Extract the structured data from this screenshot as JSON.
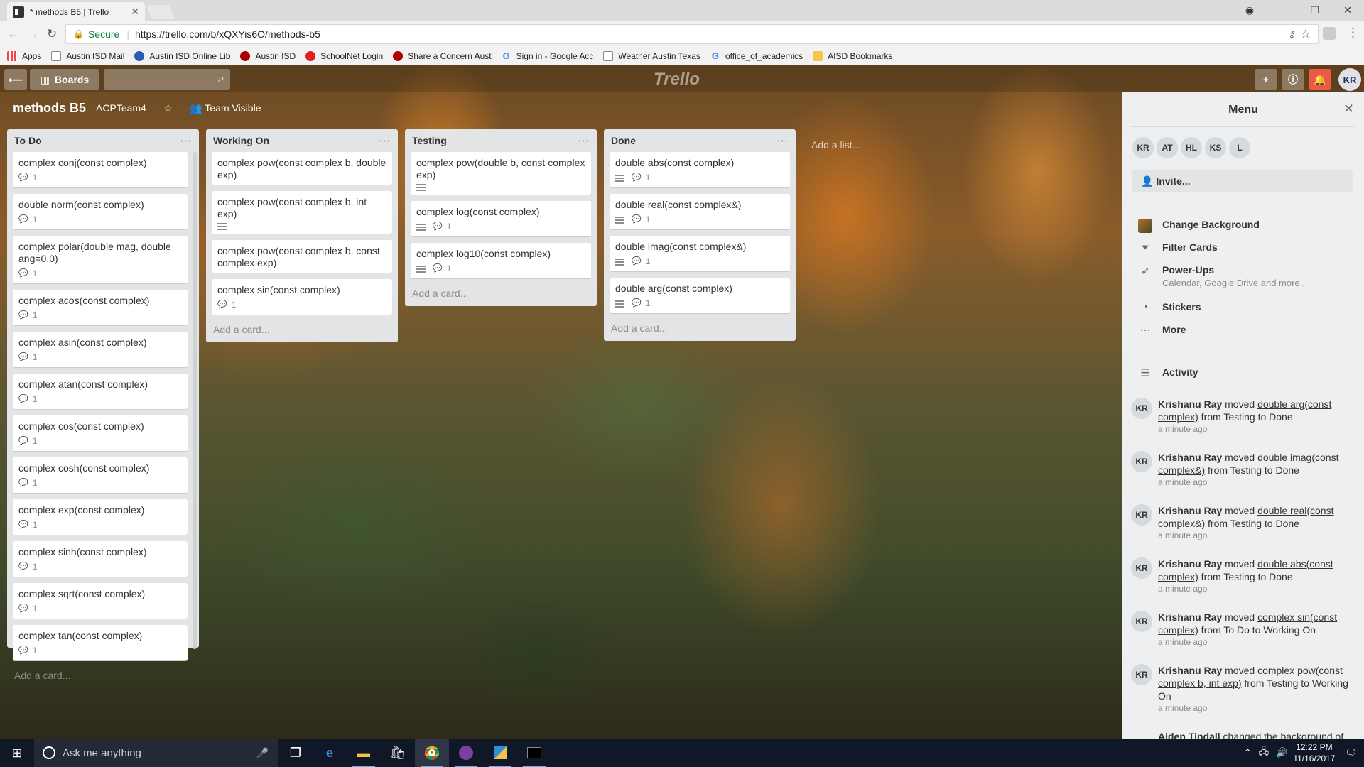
{
  "browser": {
    "tab_title": "* methods B5 | Trello",
    "secure_label": "Secure",
    "url": "https://trello.com/b/xQXYis6O/methods-b5",
    "bookmarks": [
      "Apps",
      "Austin ISD Mail",
      "Austin ISD Online Lib",
      "Austin ISD",
      "SchoolNet Login",
      "Share a Concern Aust",
      "Sign in - Google Acc",
      "Weather Austin Texas",
      "office_of_academics",
      "AISD Bookmarks"
    ]
  },
  "trello": {
    "boards_label": "Boards",
    "logo": "Trello",
    "avatar": "KR",
    "board_title": "methods B5",
    "team": "ACPTeam4",
    "visibility": "Team Visible",
    "add_list": "Add a list...",
    "add_card": "Add a card...",
    "lists": [
      {
        "title": "To Do",
        "cards": [
          {
            "text": "complex conj(const complex)",
            "desc": false,
            "comments": "1"
          },
          {
            "text": "double norm(const complex)",
            "desc": false,
            "comments": "1"
          },
          {
            "text": "complex polar(double mag, double ang=0.0)",
            "desc": false,
            "comments": "1"
          },
          {
            "text": "complex acos(const complex)",
            "desc": false,
            "comments": "1"
          },
          {
            "text": "complex asin(const complex)",
            "desc": false,
            "comments": "1"
          },
          {
            "text": "complex atan(const complex)",
            "desc": false,
            "comments": "1"
          },
          {
            "text": "complex cos(const complex)",
            "desc": false,
            "comments": "1"
          },
          {
            "text": "complex cosh(const complex)",
            "desc": false,
            "comments": "1"
          },
          {
            "text": "complex exp(const complex)",
            "desc": false,
            "comments": "1"
          },
          {
            "text": "complex sinh(const complex)",
            "desc": false,
            "comments": "1"
          },
          {
            "text": "complex sqrt(const complex)",
            "desc": false,
            "comments": "1"
          },
          {
            "text": "complex tan(const complex)",
            "desc": false,
            "comments": "1"
          }
        ]
      },
      {
        "title": "Working On",
        "cards": [
          {
            "text": "complex pow(const complex b, double exp)",
            "desc": false,
            "comments": ""
          },
          {
            "text": "complex pow(const complex b, int exp)",
            "desc": true,
            "comments": ""
          },
          {
            "text": "complex pow(const complex b, const complex exp)",
            "desc": false,
            "comments": ""
          },
          {
            "text": "complex sin(const complex)",
            "desc": false,
            "comments": "1"
          }
        ]
      },
      {
        "title": "Testing",
        "cards": [
          {
            "text": "complex pow(double b, const complex exp)",
            "desc": true,
            "comments": ""
          },
          {
            "text": "complex log(const complex)",
            "desc": true,
            "comments": "1"
          },
          {
            "text": "complex log10(const complex)",
            "desc": true,
            "comments": "1"
          }
        ]
      },
      {
        "title": "Done",
        "cards": [
          {
            "text": "double abs(const complex)",
            "desc": true,
            "comments": "1"
          },
          {
            "text": "double real(const complex&)",
            "desc": true,
            "comments": "1"
          },
          {
            "text": "double imag(const complex&)",
            "desc": true,
            "comments": "1"
          },
          {
            "text": "double arg(const complex)",
            "desc": true,
            "comments": "1"
          }
        ]
      }
    ],
    "menu": {
      "title": "Menu",
      "members": [
        "KR",
        "AT",
        "HL",
        "KS",
        "L"
      ],
      "invite": "Invite...",
      "items": [
        {
          "label": "Change Background",
          "sub": ""
        },
        {
          "label": "Filter Cards",
          "sub": ""
        },
        {
          "label": "Power-Ups",
          "sub": "Calendar, Google Drive and more..."
        },
        {
          "label": "Stickers",
          "sub": ""
        },
        {
          "label": "More",
          "sub": ""
        }
      ],
      "activity_label": "Activity",
      "activity": [
        {
          "initials": "KR",
          "user": "Krishanu Ray",
          "verb": " moved ",
          "card": "double arg(const complex)",
          "rest": " from Testing to Done",
          "time": "a minute ago"
        },
        {
          "initials": "KR",
          "user": "Krishanu Ray",
          "verb": " moved ",
          "card": "double imag(const complex&)",
          "rest": " from Testing to Done",
          "time": "a minute ago"
        },
        {
          "initials": "KR",
          "user": "Krishanu Ray",
          "verb": " moved ",
          "card": "double real(const complex&)",
          "rest": " from Testing to Done",
          "time": "a minute ago"
        },
        {
          "initials": "KR",
          "user": "Krishanu Ray",
          "verb": " moved ",
          "card": "double abs(const complex)",
          "rest": " from Testing to Done",
          "time": "a minute ago"
        },
        {
          "initials": "KR",
          "user": "Krishanu Ray",
          "verb": " moved ",
          "card": "complex sin(const complex)",
          "rest": " from To Do to Working On",
          "time": "a minute ago"
        },
        {
          "initials": "KR",
          "user": "Krishanu Ray",
          "verb": " moved ",
          "card": "complex pow(const complex b, int exp)",
          "rest": " from Testing to Working On",
          "time": "a minute ago"
        },
        {
          "initials": "",
          "user": "Aiden Tindall",
          "verb": " changed the background of",
          "card": "",
          "rest": "",
          "time": ""
        }
      ]
    }
  },
  "taskbar": {
    "search_placeholder": "Ask me anything",
    "time": "12:22 PM",
    "date": "11/16/2017"
  }
}
